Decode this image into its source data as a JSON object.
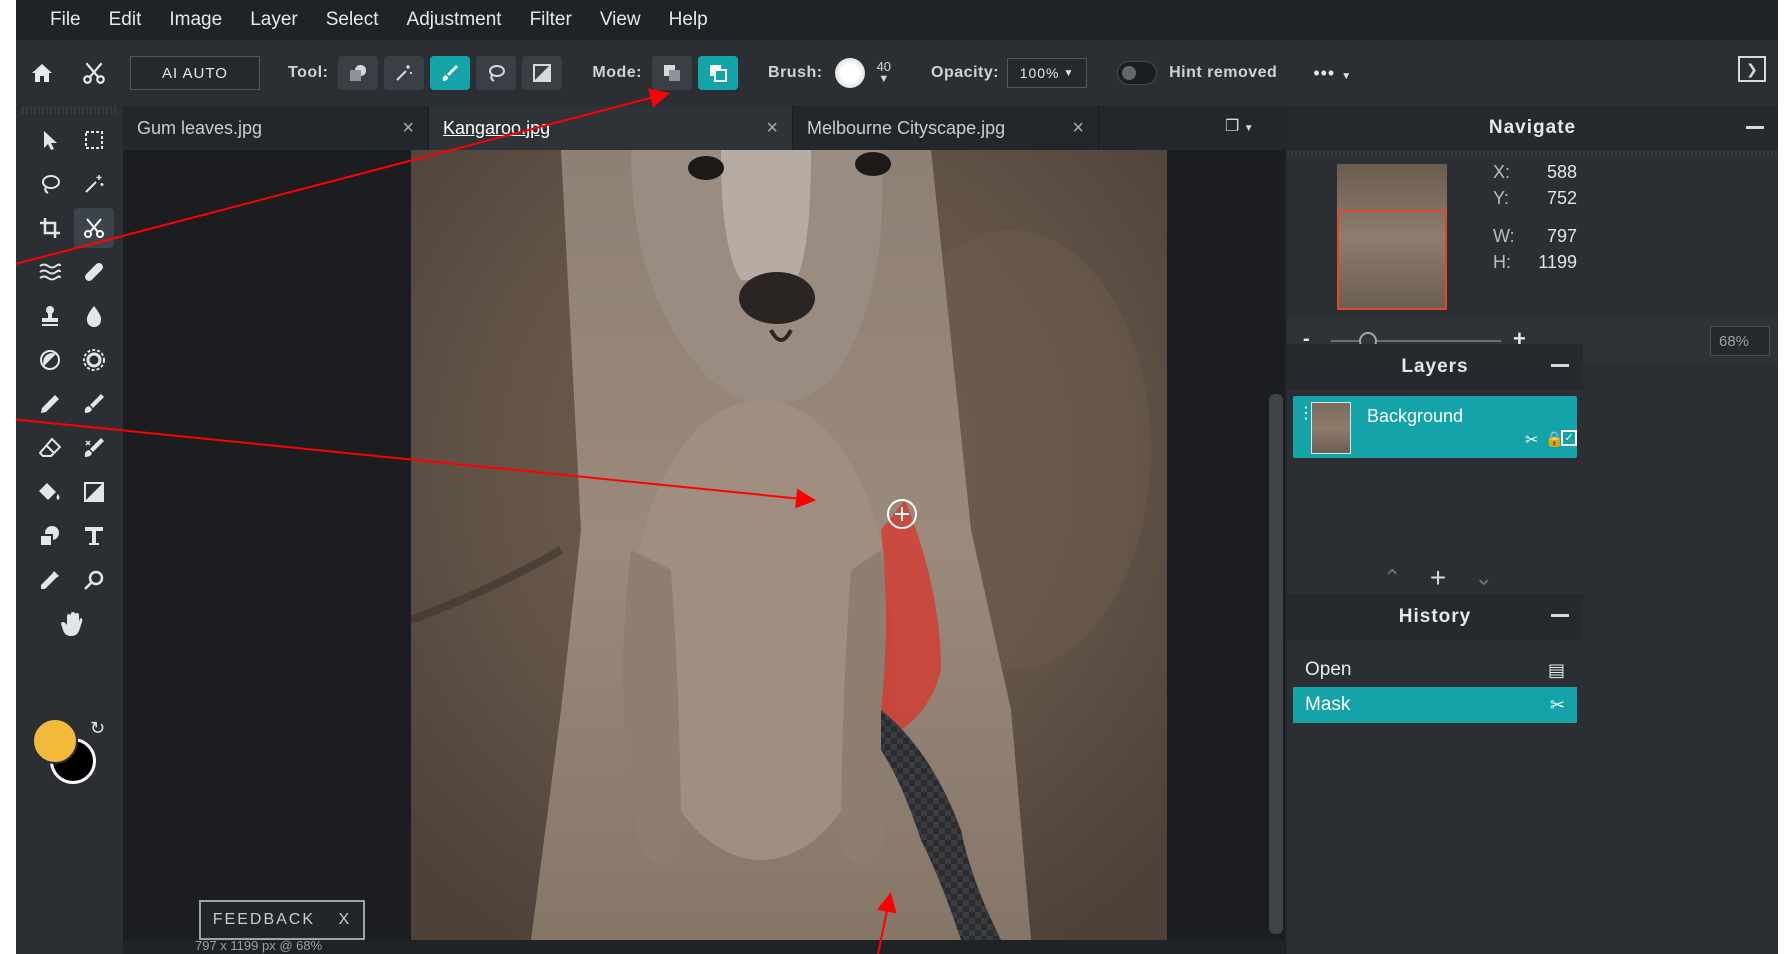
{
  "menu": [
    "File",
    "Edit",
    "Image",
    "Layer",
    "Select",
    "Adjustment",
    "Filter",
    "View",
    "Help"
  ],
  "options": {
    "ai_auto": "AI AUTO",
    "tool_label": "Tool:",
    "mode_label": "Mode:",
    "brush_label": "Brush:",
    "brush_size": "40",
    "opacity_label": "Opacity:",
    "opacity_value": "100%",
    "hint_label": "Hint removed",
    "more": "•••"
  },
  "tabs": [
    {
      "label": "Gum leaves.jpg",
      "close": "×"
    },
    {
      "label": "Kangaroo.jpg",
      "close": "×"
    },
    {
      "label": "Melbourne Cityscape.jpg",
      "close": "×"
    }
  ],
  "navigate": {
    "title": "Navigate",
    "x_label": "X:",
    "x": "588",
    "y_label": "Y:",
    "y": "752",
    "w_label": "W:",
    "w": "797",
    "h_label": "H:",
    "h": "1199",
    "zoom_minus": "-",
    "zoom_plus": "+",
    "zoom": "68%"
  },
  "layers": {
    "title": "Layers",
    "items": [
      {
        "name": "Background"
      }
    ]
  },
  "history": {
    "title": "History",
    "items": [
      {
        "label": "Open"
      },
      {
        "label": "Mask"
      }
    ]
  },
  "status": {
    "dimensions": "797 x 1199 px @ 68%",
    "feedback": "FEEDBACK",
    "feedback_close": "X"
  },
  "colors": {
    "accent": "#14a3a8",
    "foreground_swatch": "#f2b93b",
    "background_swatch": "#000000",
    "mask_red": "#d9342b",
    "annotation_arrow": "#ff0000"
  }
}
